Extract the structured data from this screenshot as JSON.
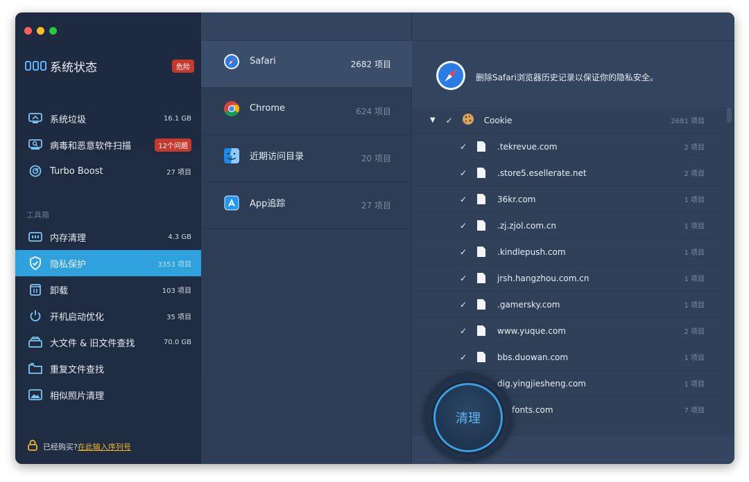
{
  "sidebar": {
    "status_title": "系统状态",
    "status_badge": "危险",
    "items_top": [
      {
        "label": "系统垃圾",
        "value": "16.1 GB",
        "icon": "trash-monitor-icon"
      },
      {
        "label": "病毒和恶意软件扫描",
        "value": "12个问题",
        "icon": "virus-scan-icon"
      },
      {
        "label": "Turbo Boost",
        "value": "27 项目",
        "icon": "turbo-boost-icon"
      }
    ],
    "toolbox_label": "工具箱",
    "tools": [
      {
        "label": "内存清理",
        "value": "4.3 GB",
        "icon": "memory-icon"
      },
      {
        "label": "隐私保护",
        "value": "3353 项目",
        "icon": "shield-icon"
      },
      {
        "label": "卸载",
        "value": "103 项目",
        "icon": "uninstall-icon"
      },
      {
        "label": "开机启动优化",
        "value": "35 项目",
        "icon": "power-icon"
      },
      {
        "label": "大文件 & 旧文件查找",
        "value": "70.0 GB",
        "icon": "large-files-icon"
      },
      {
        "label": "重复文件查找",
        "value": "",
        "icon": "duplicate-files-icon"
      },
      {
        "label": "相似照片清理",
        "value": "",
        "icon": "photo-icon"
      }
    ],
    "bought_text": "已经购买?",
    "serial_link": "在此输入序列号"
  },
  "browsers": [
    {
      "name": "Safari",
      "count": "2682 项目",
      "icon": "safari-icon"
    },
    {
      "name": "Chrome",
      "count": "624 项目",
      "icon": "chrome-icon"
    },
    {
      "name": "近期访问目录",
      "count": "20 项目",
      "icon": "finder-icon"
    },
    {
      "name": "App追踪",
      "count": "27 项目",
      "icon": "app-store-icon"
    }
  ],
  "detail": {
    "header_text": "删除Safari浏览器历史记录以保证你的隐私安全。",
    "group": {
      "label": "Cookie",
      "count": "2681 项目"
    },
    "entries": [
      {
        "domain": ".tekrevue.com",
        "count": "2 项目"
      },
      {
        "domain": ".store5.esellerate.net",
        "count": "2 项目"
      },
      {
        "domain": "36kr.com",
        "count": "1 项目"
      },
      {
        "domain": ".zj.zjol.com.cn",
        "count": "1 项目"
      },
      {
        "domain": ".kindlepush.com",
        "count": "1 项目"
      },
      {
        "domain": "jrsh.hangzhou.com.cn",
        "count": "1 项目"
      },
      {
        "domain": ".gamersky.com",
        "count": "1 项目"
      },
      {
        "domain": "www.yuque.com",
        "count": "2 项目"
      },
      {
        "domain": "bbs.duowan.com",
        "count": "1 项目"
      },
      {
        "domain": "dig.yingjiesheng.com",
        "count": "1 项目"
      },
      {
        "domain": "fonts.com",
        "count": "7 项目"
      }
    ]
  },
  "clean_button": "清理"
}
